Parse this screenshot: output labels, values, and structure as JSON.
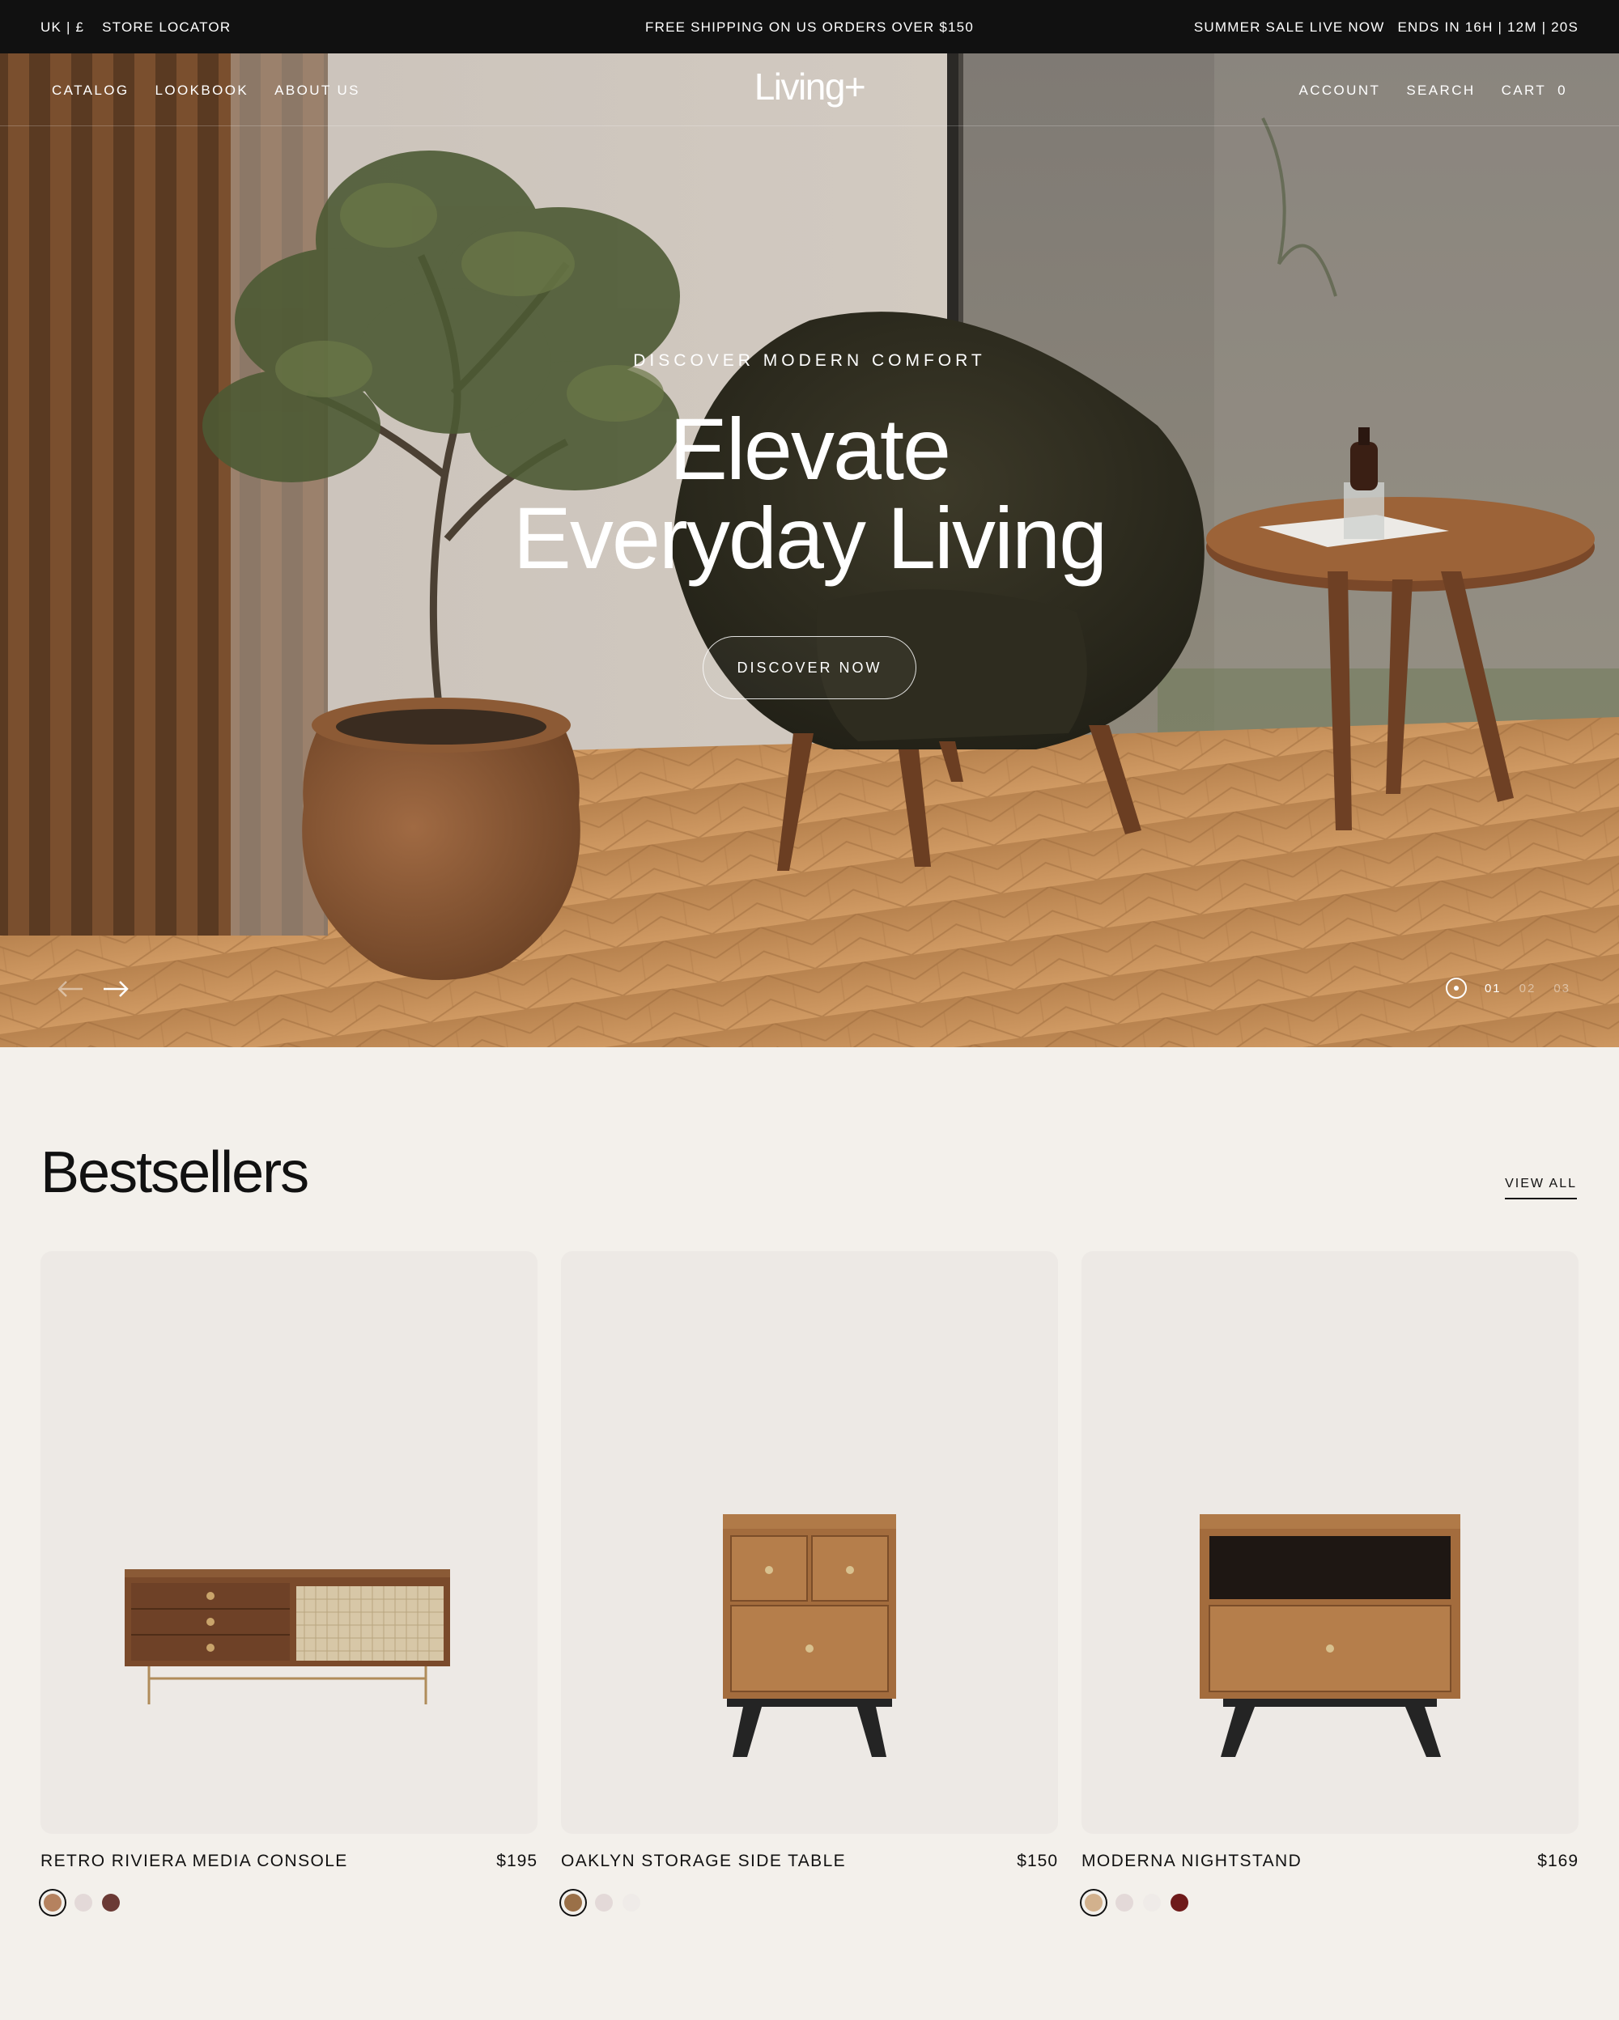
{
  "announcement": {
    "region": "UK | £",
    "store_locator": "STORE LOCATOR",
    "shipping": "FREE SHIPPING ON US ORDERS OVER $150",
    "sale": "SUMMER SALE LIVE NOW",
    "countdown": "ENDS IN 16H | 12M | 20S"
  },
  "nav": {
    "left": [
      "CATALOG",
      "LOOKBOOK",
      "ABOUT US"
    ],
    "logo": "Living+",
    "account": "ACCOUNT",
    "search": "SEARCH",
    "cart_label": "CART",
    "cart_count": "0"
  },
  "hero": {
    "eyebrow": "DISCOVER MODERN COMFORT",
    "headline_line1": "Elevate",
    "headline_line2": "Everyday Living",
    "cta": "DISCOVER NOW",
    "slides": [
      "01",
      "02",
      "03"
    ],
    "active_slide": "01"
  },
  "bestsellers": {
    "title": "Bestsellers",
    "view_all": "VIEW ALL",
    "products": [
      {
        "name": "RETRO RIVIERA MEDIA CONSOLE",
        "price": "$195",
        "swatches": [
          "#b5825f",
          "#e3d9d8",
          "#6b3a35"
        ],
        "selected_swatch": 0
      },
      {
        "name": "OAKLYN STORAGE SIDE TABLE",
        "price": "$150",
        "swatches": [
          "#9a7048",
          "#e3d9d8",
          "#efebe8"
        ],
        "selected_swatch": 0
      },
      {
        "name": "MODERNA NIGHTSTAND",
        "price": "$169",
        "swatches": [
          "#d2b18d",
          "#e3d9d8",
          "#efebe8",
          "#6e1a1a"
        ],
        "selected_swatch": 0
      }
    ]
  },
  "colors": {
    "topbar_bg": "#111111",
    "page_bg": "#f3f0eb",
    "card_bg": "#ede9e5"
  }
}
